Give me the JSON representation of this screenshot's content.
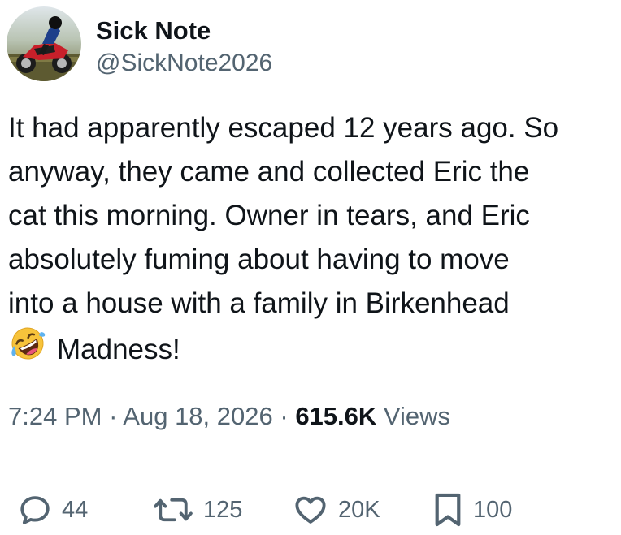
{
  "author": {
    "display_name": "Sick Note",
    "handle": "@SickNote2026"
  },
  "tweet": {
    "lines": [
      "It had apparently escaped 12 years ago. So",
      "anyway, they came and collected Eric the",
      "cat this morning. Owner in tears, and Eric",
      "absolutely fuming about having to move",
      "into a house with a family in Birkenhead"
    ],
    "last_line": "Madness!",
    "emoji": "rolling-on-the-floor-laughing"
  },
  "meta": {
    "time": "7:24 PM",
    "separator": " · ",
    "date": "Aug 18, 2026",
    "views_count": "615.6K",
    "views_label": "Views"
  },
  "actions": {
    "replies": "44",
    "reposts": "125",
    "likes": "20K",
    "bookmarks": "100"
  },
  "colors": {
    "text": "#0f1419",
    "secondary": "#536471",
    "divider": "#eff3f4"
  }
}
